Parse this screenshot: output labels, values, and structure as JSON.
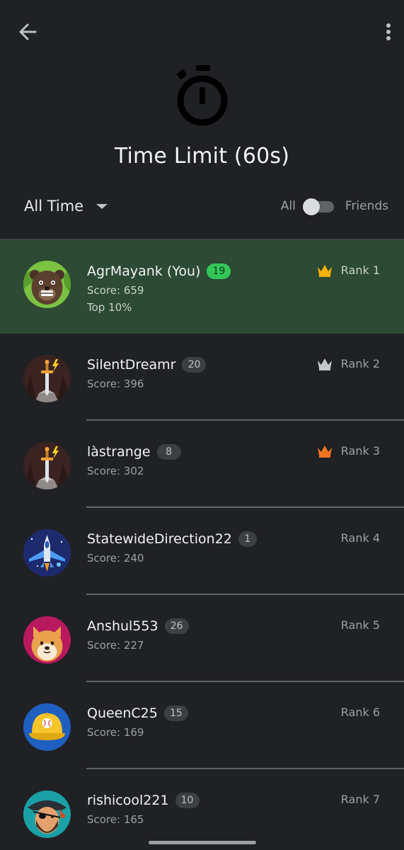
{
  "header": {
    "title": "Time Limit (60s)",
    "back_icon": "arrow-back-icon",
    "menu_icon": "more-vert-icon",
    "mode_icon": "stopwatch-icon"
  },
  "filters": {
    "period": "All Time",
    "scope_left": "All",
    "scope_right": "Friends",
    "friends_only": false
  },
  "leaderboard": [
    {
      "name": "AgrMayank (You)",
      "level": "19",
      "score": "Score: 659",
      "percentile": "Top 10%",
      "rank": "Rank 1",
      "crown": "gold",
      "avatar": "bear",
      "is_me": true
    },
    {
      "name": "SilentDreamr",
      "level": "20",
      "score": "Score: 396",
      "rank": "Rank 2",
      "crown": "silver",
      "avatar": "sword"
    },
    {
      "name": "làstrange",
      "level": "8",
      "score": "Score: 302",
      "rank": "Rank 3",
      "crown": "bronze",
      "avatar": "sword"
    },
    {
      "name": "StatewideDirection22",
      "level": "1",
      "score": "Score: 240",
      "rank": "Rank 4",
      "crown": "",
      "avatar": "jet"
    },
    {
      "name": "Anshul553",
      "level": "26",
      "score": "Score: 227",
      "rank": "Rank 5",
      "crown": "",
      "avatar": "doge"
    },
    {
      "name": "QueenC25",
      "level": "15",
      "score": "Score: 169",
      "rank": "Rank 6",
      "crown": "",
      "avatar": "cap"
    },
    {
      "name": "rishicool221",
      "level": "10",
      "score": "Score: 165",
      "rank": "Rank 7",
      "crown": "",
      "avatar": "pirate"
    }
  ],
  "colors": {
    "background": "#202124",
    "me_row": "#2c4a34",
    "level_badge_me": "#34c759",
    "crown_gold": "#f9b208",
    "crown_silver": "#c4c7cc",
    "crown_bronze": "#f0731f"
  }
}
